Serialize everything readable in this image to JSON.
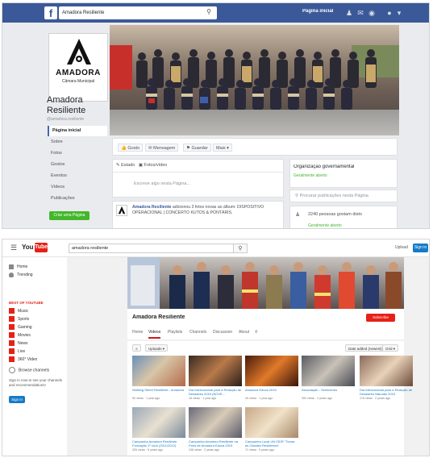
{
  "facebook": {
    "search_value": "Amadora Resiliente",
    "home_link": "Página inicial",
    "logo_word": "AMADORA",
    "logo_sub": "Câmara Municipal",
    "page_name_line1": "Amadora",
    "page_name_line2": "Resiliente",
    "page_handle": "@amadora.resiliente",
    "nav": [
      "Página inicial",
      "Sobre",
      "Fotos",
      "Gostos",
      "Eventos",
      "Vídeos",
      "Publicações"
    ],
    "create_page": "Criar uma Página",
    "actions": {
      "like": "Gosto",
      "message": "Mensagem",
      "save": "Guardar",
      "more": "Mais"
    },
    "composer": {
      "status": "Estado",
      "photos": "Fotos/vídeo",
      "placeholder": "Escreve algo nesta Página..."
    },
    "post": {
      "author": "Amadora Resiliente",
      "text": "adicionou 3 fotos novas ao álbum: DISPOSITIVO OPERACIONAL | CONCERTO KUTOS & PONTÁRIS."
    },
    "info": {
      "category": "Organização governamental",
      "status": "Geralmente aberto"
    },
    "search_posts": "Procurar publicações nesta Página",
    "likes": {
      "count_text": "2240 pessoas gostam disto",
      "status": "Geralmente aberto"
    },
    "colors": {
      "brand": "#3b5998",
      "green": "#42b72a"
    }
  },
  "youtube": {
    "search_value": "amadora resiliente",
    "upload": "Upload",
    "sign_in": "Sign in",
    "sidebar": {
      "home": "Home",
      "trending": "Trending",
      "best_of": "BEST OF YOUTUBE",
      "categories": [
        "Music",
        "Sports",
        "Gaming",
        "Movies",
        "News",
        "Live",
        "360° Video"
      ],
      "browse": "Browse channels",
      "signin_message": "Sign in now to see your channels and recommendations!",
      "signin_button": "Sign in"
    },
    "channel_title": "Amadora Resiliente",
    "subscribe": "Subscribe",
    "tabs": [
      "Home",
      "Videos",
      "Playlists",
      "Channels",
      "Discussion",
      "About"
    ],
    "active_tab": "Videos",
    "filter_buttons": {
      "list": "≡",
      "uploads": "Uploads",
      "sort": "Date added (newest)",
      "grid": "Grid"
    },
    "videos": [
      {
        "title": "Walking Street Resiliente - Amadora",
        "meta": "50 views · 1 year ago"
      },
      {
        "title": "Dia Internacional para a Redução de Desastres 2015 (NOVE...",
        "meta": "18 views · 1 year ago"
      },
      {
        "title": "Amadora Educa 2015",
        "meta": "49 views · 1 year ago"
      },
      {
        "title": "Associação - Semicentro",
        "meta": "300 views · 2 years ago"
      },
      {
        "title": "Dia Internacional para a Redução de Desastres Naturais 2015",
        "meta": "176 views · 2 years ago"
      },
      {
        "title": "Campanha Amadora Resiliente Formação 1º ciclo (2011/2012)",
        "meta": "326 views · 5 years ago"
      },
      {
        "title": "Campanha Amadora Resiliente na Feira de Amadora Educa 2015",
        "meta": "248 views · 2 years ago"
      },
      {
        "title": "Campanha Local UN ISDR \"Tornar as Cidades Resilientes\"",
        "meta": "71 views · 5 years ago"
      }
    ],
    "colors": {
      "red": "#e62117",
      "blue": "#167ac6"
    }
  }
}
